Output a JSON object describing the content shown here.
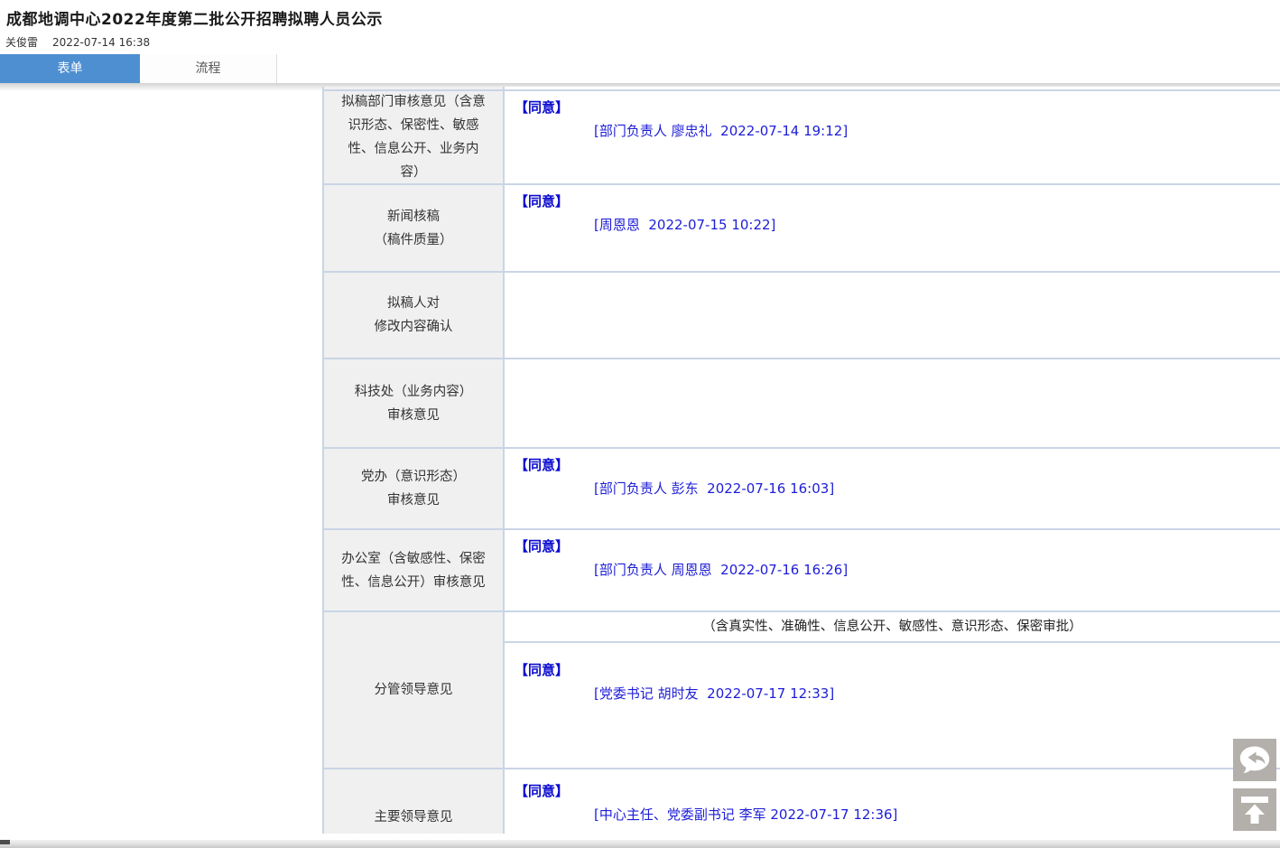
{
  "header": {
    "title": "成都地调中心2022年度第二批公开招聘拟聘人员公示",
    "author": "关俊雷",
    "created_at": "2022-07-14 16:38"
  },
  "tabs": {
    "form_label": "表单",
    "process_label": "流程",
    "active_tab": "表单"
  },
  "approval_rows": [
    {
      "label": "拟稿部门审核意见（含意识形态、保密性、敏感性、信息公开、业务内容）",
      "label_lines": [
        "拟稿部门审核意见（含意",
        "识形态、保密性、敏感",
        "性、信息公开、业务内",
        "容）"
      ],
      "decision": "【同意】",
      "signer": "[部门负责人 廖忠礼  2022-07-14 19:12]",
      "note": null
    },
    {
      "label": "新闻核稿（稿件质量）",
      "label_lines": [
        "新闻核稿",
        "（稿件质量）"
      ],
      "decision": "【同意】",
      "signer": "[周恩恩  2022-07-15 10:22]",
      "note": null
    },
    {
      "label": "拟稿人对修改内容确认",
      "label_lines": [
        "拟稿人对",
        "修改内容确认"
      ],
      "decision": "",
      "signer": "",
      "note": null
    },
    {
      "label": "科技处（业务内容）审核意见",
      "label_lines": [
        "科技处（业务内容）",
        "审核意见"
      ],
      "decision": "",
      "signer": "",
      "note": null
    },
    {
      "label": "党办（意识形态）审核意见",
      "label_lines": [
        "党办（意识形态）",
        "审核意见"
      ],
      "decision": "【同意】",
      "signer": "[部门负责人 彭东  2022-07-16 16:03]",
      "note": null
    },
    {
      "label": "办公室（含敏感性、保密性、信息公开）审核意见",
      "label_lines": [
        "办公室（含敏感性、保密",
        "性、信息公开）审核意见"
      ],
      "decision": "【同意】",
      "signer": "[部门负责人 周恩恩  2022-07-16 16:26]",
      "note": null
    },
    {
      "label": "分管领导意见",
      "label_lines": [
        "分管领导意见"
      ],
      "decision": "【同意】",
      "signer": "[党委书记 胡时友  2022-07-17 12:33]",
      "note": "（含真实性、准确性、信息公开、敏感性、意识形态、保密审批）"
    },
    {
      "label": "主要领导意见",
      "label_lines": [
        "主要领导意见"
      ],
      "decision": "【同意】",
      "signer": "[中心主任、党委副书记 李军 2022-07-17 12:36]",
      "note": null
    }
  ],
  "floating_buttons": {
    "reply": "reply-comment",
    "back_to_top": "back-to-top"
  },
  "colors": {
    "tab_active_blue": "#4e8fd2",
    "approval_text_blue": "#0b0bd0",
    "table_border": "#c9d5e6",
    "label_cell_bg": "#f0f0f0",
    "fab_gray": "#b3afaa"
  }
}
